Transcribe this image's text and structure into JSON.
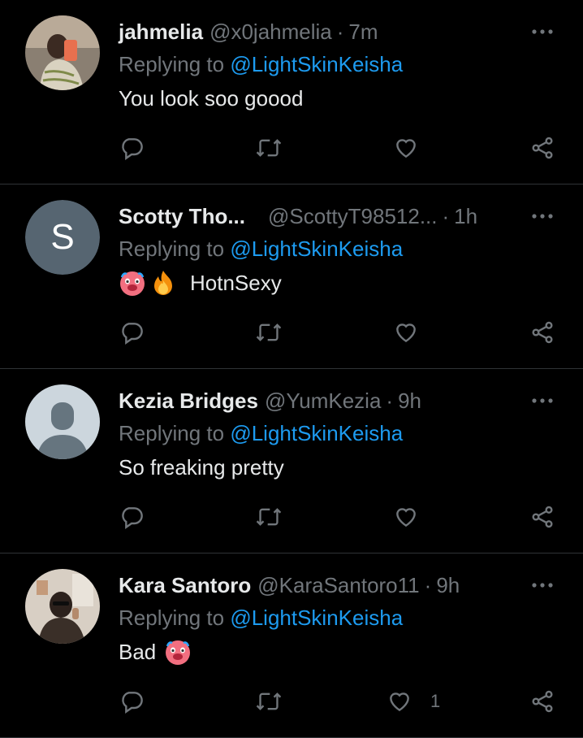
{
  "replies": [
    {
      "name": "jahmelia",
      "handle": "@x0jahmelia",
      "time": "7m",
      "replying_prefix": "Replying to",
      "replying_to": "@LightSkinKeisha",
      "text": "You look soo goood",
      "avatar": "photo-avatar",
      "likes": ""
    },
    {
      "name": "Scotty Tho...",
      "handle": "@ScottyT98512...",
      "time": "1h",
      "replying_prefix": "Replying to",
      "replying_to": "@LightSkinKeisha",
      "text": "HotnSexy",
      "emojis": [
        "hot-face-emoji",
        "fire-emoji"
      ],
      "avatar_letter": "S",
      "likes": ""
    },
    {
      "name": "Kezia Bridges",
      "handle": "@YumKezia",
      "time": "9h",
      "replying_prefix": "Replying to",
      "replying_to": "@LightSkinKeisha",
      "text": "So freaking pretty",
      "avatar": "default-profile-avatar",
      "likes": ""
    },
    {
      "name": "Kara Santoro",
      "handle": "@KaraSantoro11",
      "time": "9h",
      "replying_prefix": "Replying to",
      "replying_to": "@LightSkinKeisha",
      "text": "Bad",
      "emojis": [
        "hot-face-emoji"
      ],
      "avatar": "photo-avatar",
      "likes": "1"
    }
  ],
  "separator": "·",
  "colors": {
    "background": "#000000",
    "text": "#e7e9ea",
    "muted": "#71767b",
    "link": "#1d9bf0",
    "divider": "#2f3336"
  },
  "icons": [
    "more-icon",
    "reply-icon",
    "retweet-icon",
    "like-icon",
    "share-icon"
  ]
}
